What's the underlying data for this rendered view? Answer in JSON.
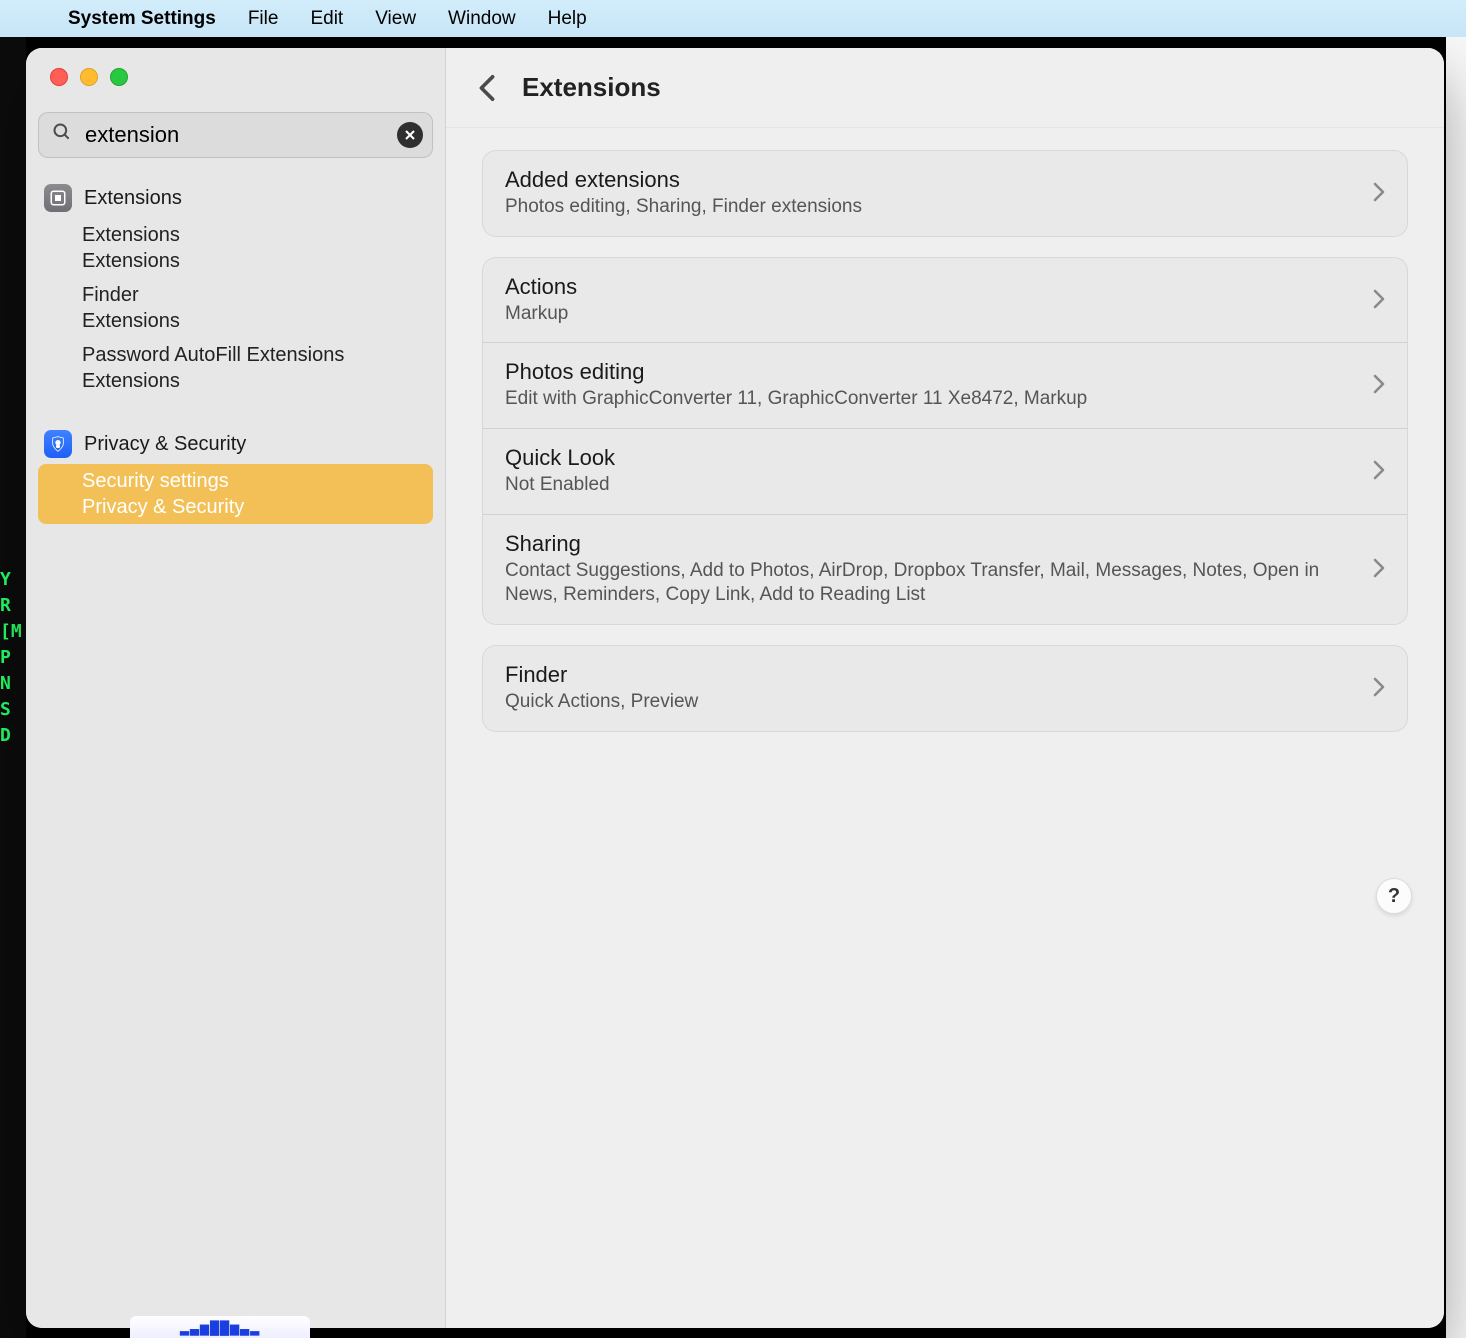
{
  "menubar": {
    "app": "System Settings",
    "items": [
      "File",
      "Edit",
      "View",
      "Window",
      "Help"
    ]
  },
  "search": {
    "value": "extension"
  },
  "sidebar": {
    "groups": [
      {
        "icon": "extensions-icon",
        "label": "Extensions",
        "items": [
          {
            "line1": "Extensions",
            "line2": "Extensions",
            "selected": false
          },
          {
            "line1": "Finder",
            "line2": "Extensions",
            "selected": false
          },
          {
            "line1": "Password AutoFill Extensions",
            "line2": "Extensions",
            "selected": false
          }
        ]
      },
      {
        "icon": "privacy-icon",
        "label": "Privacy & Security",
        "items": [
          {
            "line1": "Security settings",
            "line2": "Privacy & Security",
            "selected": true
          }
        ]
      }
    ]
  },
  "content": {
    "title": "Extensions",
    "sections": [
      {
        "rows": [
          {
            "title": "Added extensions",
            "sub": "Photos editing, Sharing, Finder extensions"
          }
        ]
      },
      {
        "rows": [
          {
            "title": "Actions",
            "sub": "Markup"
          },
          {
            "title": "Photos editing",
            "sub": "Edit with GraphicConverter 11, GraphicConverter 11 Xe8472, Markup"
          },
          {
            "title": "Quick Look",
            "sub": "Not Enabled"
          },
          {
            "title": "Sharing",
            "sub": "Contact Suggestions, Add to Photos, AirDrop, Dropbox Transfer, Mail, Messages, Notes, Open in News, Reminders, Copy Link, Add to Reading List"
          }
        ]
      },
      {
        "rows": [
          {
            "title": "Finder",
            "sub": "Quick Actions, Preview"
          }
        ]
      }
    ]
  },
  "help_label": "?",
  "terminal_lines": [
    "Y",
    "R",
    "[M",
    "P",
    "",
    "N",
    "",
    "S",
    "",
    "",
    "",
    "D"
  ]
}
